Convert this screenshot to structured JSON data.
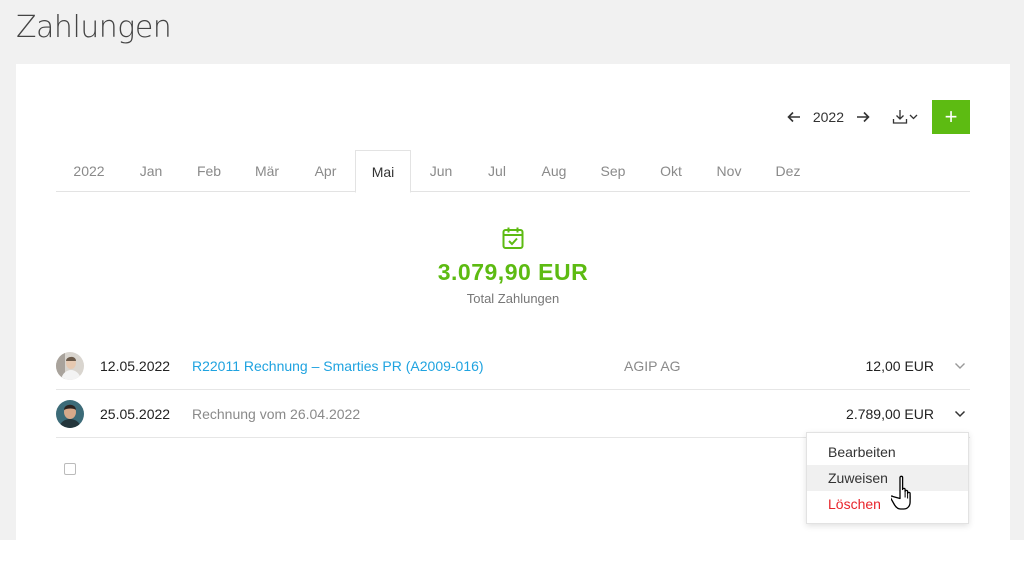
{
  "page": {
    "title": "Zahlungen"
  },
  "toolbar": {
    "prev_icon": "arrow-left-icon",
    "year": "2022",
    "next_icon": "arrow-right-icon",
    "download_icon": "download-icon",
    "add_label": "+"
  },
  "tabs": [
    {
      "label": "2022",
      "active": false
    },
    {
      "label": "Jan",
      "active": false
    },
    {
      "label": "Feb",
      "active": false
    },
    {
      "label": "Mär",
      "active": false
    },
    {
      "label": "Apr",
      "active": false
    },
    {
      "label": "Mai",
      "active": true
    },
    {
      "label": "Jun",
      "active": false
    },
    {
      "label": "Jul",
      "active": false
    },
    {
      "label": "Aug",
      "active": false
    },
    {
      "label": "Sep",
      "active": false
    },
    {
      "label": "Okt",
      "active": false
    },
    {
      "label": "Nov",
      "active": false
    },
    {
      "label": "Dez",
      "active": false
    }
  ],
  "summary": {
    "icon": "calendar-check-icon",
    "total": "3.079,90 EUR",
    "label": "Total Zahlungen"
  },
  "payments": [
    {
      "date": "12.05.2022",
      "description": "R22011 Rechnung – Smarties PR (A2009-016)",
      "party": "AGIP AG",
      "amount": "12,00 EUR"
    },
    {
      "date": "25.05.2022",
      "description": "Rechnung vom 26.04.2022",
      "party": "",
      "amount": "2.789,00 EUR"
    }
  ],
  "row_menu": {
    "items": [
      "Bearbeiten",
      "Zuweisen",
      "Löschen"
    ]
  },
  "colors": {
    "accent": "#5dbb12",
    "link": "#1fa3e0",
    "danger": "#e8252b"
  }
}
